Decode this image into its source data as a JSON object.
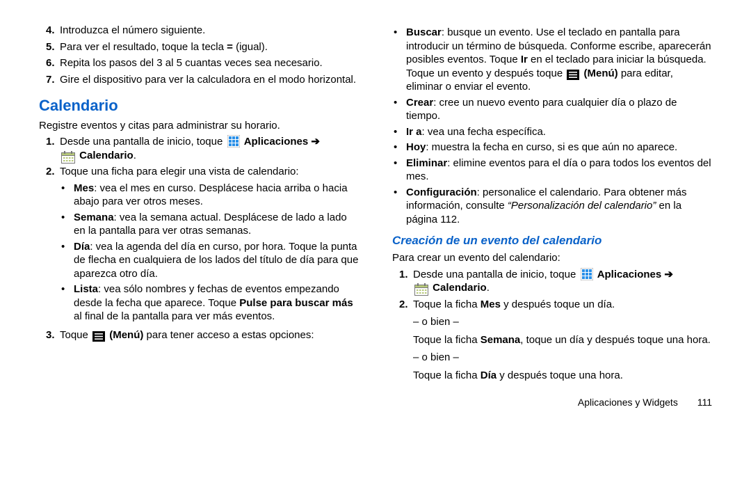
{
  "left": {
    "ol1": [
      {
        "n": "4.",
        "text": "Introduzca el número siguiente."
      },
      {
        "n": "5.",
        "text_a": "Para ver el resultado, toque la tecla ",
        "b": "=",
        "text_b": " (igual)."
      },
      {
        "n": "6.",
        "text": "Repita los pasos del 3 al 5 cuantas veces sea necesario."
      },
      {
        "n": "7.",
        "text": "Gire el dispositivo para ver la calculadora en el modo horizontal."
      }
    ],
    "h2": "Calendario",
    "intro": "Registre eventos y citas para administrar su horario.",
    "ol2": {
      "step1_a": "Desde una pantalla de inicio, toque ",
      "step1_apps": "Aplicaciones",
      "step1_arrow": " ➔",
      "step1_cal": "Calendario",
      "step1_dot": ".",
      "step2": "Toque una ficha para elegir una vista de calendario:",
      "views": [
        {
          "b": "Mes",
          "t": ": vea el mes en curso. Desplácese hacia arriba o hacia abajo para ver otros meses."
        },
        {
          "b": "Semana",
          "t": ": vea la semana actual. Desplácese de lado a lado en la pantalla para ver otras semanas."
        },
        {
          "b": "Día",
          "t": ": vea la agenda del día en curso, por hora. Toque la punta de flecha en cualquiera de los lados del título de día para que aparezca otro día."
        },
        {
          "b": "Lista",
          "t": ": vea sólo nombres y fechas de eventos empezando desde la fecha que aparece. Toque ",
          "b2": "Pulse para buscar más",
          "t2": " al final de la pantalla para ver más eventos."
        }
      ],
      "step3_a": "Toque ",
      "step3_menu": "(Menú)",
      "step3_b": " para tener acceso a estas opciones:"
    }
  },
  "right": {
    "opts": [
      {
        "b": "Buscar",
        "t": ": busque un evento. Use el teclado en pantalla para introducir un término de búsqueda. Conforme escribe, aparecerán posibles eventos. Toque ",
        "b2": "Ir",
        "t2": " en el teclado para iniciar la búsqueda. Toque un evento y después toque ",
        "menu": "(Menú)",
        "t3": " para editar, eliminar o enviar el evento."
      },
      {
        "b": "Crear",
        "t": ": cree un nuevo evento para cualquier día o plazo de tiempo."
      },
      {
        "b": "Ir a",
        "t": ": vea una fecha específica."
      },
      {
        "b": "Hoy",
        "t": ": muestra la fecha en curso, si es que aún no aparece."
      },
      {
        "b": "Eliminar",
        "t": ": elimine eventos para el día o para todos los eventos del mes."
      },
      {
        "b": "Configuración",
        "t": ": personalice el calendario. Para obtener más información, consulte ",
        "i": "“Personalización del calendario”",
        "t2": " en la página 112."
      }
    ],
    "h3": "Creación de un evento del calendario",
    "intro": "Para crear un evento del calendario:",
    "step1_a": "Desde una pantalla de inicio, toque ",
    "step1_apps": "Aplicaciones",
    "step1_arrow": " ➔",
    "step1_cal": "Calendario",
    "step1_dot": ".",
    "step2_a": "Toque la ficha ",
    "step2_b": "Mes",
    "step2_c": " y después toque un día.",
    "obien": "– o bien –",
    "semana_a": "Toque la ficha ",
    "semana_b": "Semana",
    "semana_c": ", toque un día y después toque una hora.",
    "dia_a": "Toque la ficha ",
    "dia_b": "Día",
    "dia_c": " y después toque una hora.",
    "footer_section": "Aplicaciones y Widgets",
    "footer_page": "111"
  },
  "icons": {
    "apps": "apps-grid-icon",
    "calendar": "calendar-icon",
    "menu": "menu-icon"
  }
}
